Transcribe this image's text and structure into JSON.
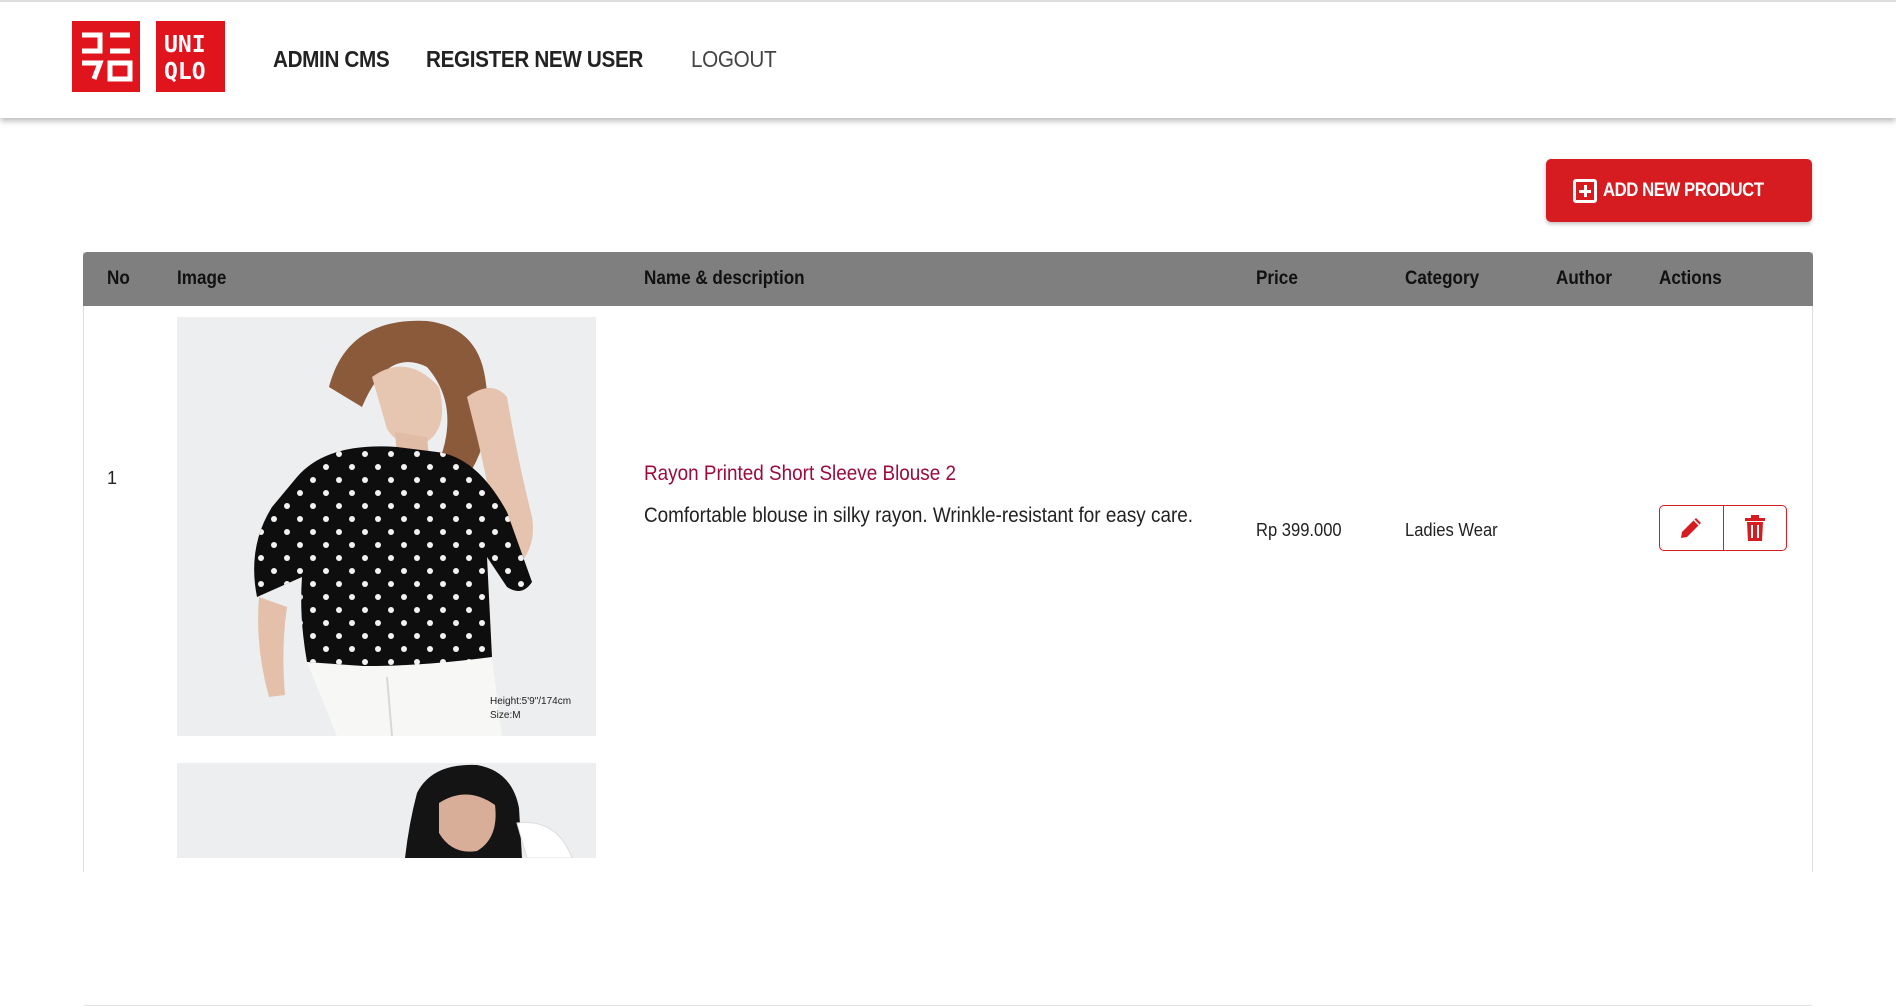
{
  "header": {
    "logo_top": "ユニクロ",
    "logo_wordmark": "UNIQLO",
    "nav": [
      {
        "label": "ADMIN CMS"
      },
      {
        "label": "REGISTER NEW USER"
      },
      {
        "label": "LOGOUT"
      }
    ]
  },
  "toolbar": {
    "add_label": "ADD NEW PRODUCT"
  },
  "table": {
    "columns": [
      "No",
      "Image",
      "Name & description",
      "Price",
      "Category",
      "Author",
      "Actions"
    ],
    "rows": [
      {
        "no": "1",
        "image_caption_1": "Height:5'9\"/174cm",
        "image_caption_2": "Size:M",
        "name": "Rayon Printed Short Sleeve Blouse 2",
        "description": "Comfortable blouse in silky rayon. Wrinkle-resistant for easy care.",
        "price": "Rp 399.000",
        "category": "Ladies Wear",
        "author": ""
      }
    ]
  },
  "colors": {
    "brand_red": "#d61c20",
    "header_bg": "#7f7f7f",
    "product_name": "#9b0b3b"
  },
  "icons": {
    "add": "plus-square-icon",
    "edit": "pencil-icon",
    "delete": "trash-icon"
  }
}
